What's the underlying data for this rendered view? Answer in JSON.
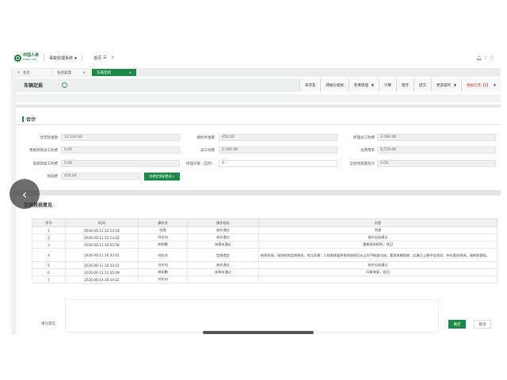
{
  "header": {
    "logo_cn": "中国人寿",
    "logo_en": "CHINA LIFE",
    "system": "事故处理系统",
    "home": "首页"
  },
  "tabs": [
    {
      "label": "主页"
    },
    {
      "label": "任务处理"
    },
    {
      "label": "车辆定损"
    }
  ],
  "page": {
    "title": "车辆定损"
  },
  "actions": [
    {
      "label": "未涉及"
    },
    {
      "label": "转报价核损"
    },
    {
      "label": "影像管理"
    },
    {
      "label": "计算"
    },
    {
      "label": "暂存"
    },
    {
      "label": "提交"
    },
    {
      "label": "更多操作"
    },
    {
      "label": "相关信息【2】"
    }
  ],
  "summary": {
    "title": "合计",
    "fields": {
      "total_loss_label": "合定损金额",
      "total_loss": "12,144.00",
      "parts_label": "换修件金额",
      "parts": "450.00",
      "repair_label": "修理总工时费",
      "repair": "2,490.00",
      "extra_label": "更换项目总工时费",
      "extra": "0.00",
      "labor_label": "总工时费",
      "labor": "2,490.00",
      "paint_label": "总费用率",
      "paint": "8,759.00",
      "outsource_label": "低碳修复工时费",
      "outsource": "0.00",
      "repair_days_label": "修理天数（自然）",
      "repair_days": "0",
      "residual_label": "全损残值量加计",
      "residual": "0.00",
      "remnant_label": "残值费",
      "remnant": "456.00",
      "calc_button": "选择定损配置录入"
    }
  },
  "opinions": {
    "title": "定损核损意见",
    "columns": [
      "序号",
      "时间",
      "操作员",
      "操作状态",
      "内容"
    ],
    "rows": [
      {
        "no": "1",
        "time": "2026-06-11 12:14:18",
        "op": "张建",
        "status": "核价通过",
        "content": "同意"
      },
      {
        "no": "2",
        "time": "2026-06-11 12:14:22",
        "op": "刘冬向",
        "status": "核价通过",
        "content": "核价自动通过"
      },
      {
        "no": "3",
        "time": "2026-06-11 16:02:58",
        "op": "胡如鹏",
        "status": "核损未通过",
        "content": "重新核实损失，驳回"
      },
      {
        "no": "4",
        "time": "2026-06-11 16:33:01",
        "op": "刘冬向",
        "status": "定损提交",
        "content": "依照现场，现场拍照定损损伤，车主同意：1.拍照修复原损伤核损后必上拉不能路况成，要求车辆报废，此事已上报中交领导，先行跟进现场，请依照保赔。",
        "tall": true
      },
      {
        "no": "5",
        "time": "2026-06-11 16:33:01",
        "op": "刘冬向",
        "status": "核价通过",
        "content": "核价自动通过"
      },
      {
        "no": "6",
        "time": "2026-06-11 21:55:09",
        "op": "胡如鹏",
        "status": "核损未通过",
        "content": "同意修复，驳回"
      },
      {
        "no": "7",
        "time": "2026-06-14 16:34:22",
        "op": "刘冬向",
        "status": "",
        "content": ""
      }
    ]
  },
  "bottom": {
    "fill_label": "填写意见",
    "confirm": "确定",
    "cancel": "取消"
  }
}
